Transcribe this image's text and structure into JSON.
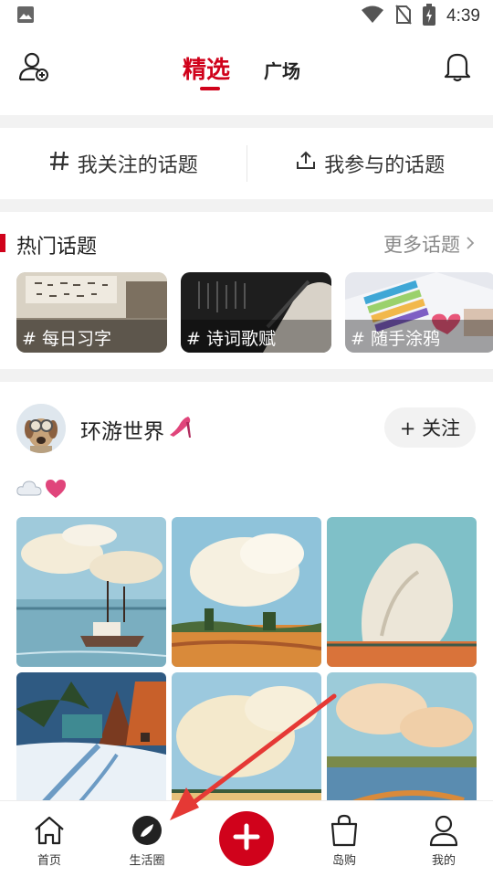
{
  "status_bar": {
    "time": "4:39"
  },
  "top_nav": {
    "tab_featured": "精选",
    "tab_square": "广场"
  },
  "topics": {
    "followed": "我关注的话题",
    "participated": "我参与的话题"
  },
  "hot_topics": {
    "title": "热门话题",
    "more": "更多话题",
    "cards": [
      {
        "label": "# 每日习字"
      },
      {
        "label": "# 诗词歌赋"
      },
      {
        "label": "# 随手涂鸦"
      }
    ]
  },
  "post": {
    "author": "环游世界",
    "follow_label": "+ 关注",
    "photo_count": 6
  },
  "bottom_nav": {
    "home": "首页",
    "life_circle": "生活圈",
    "island_shop": "岛购",
    "mine": "我的"
  },
  "colors": {
    "accent": "#d0021b",
    "annotation_arrow": "#e53935"
  }
}
